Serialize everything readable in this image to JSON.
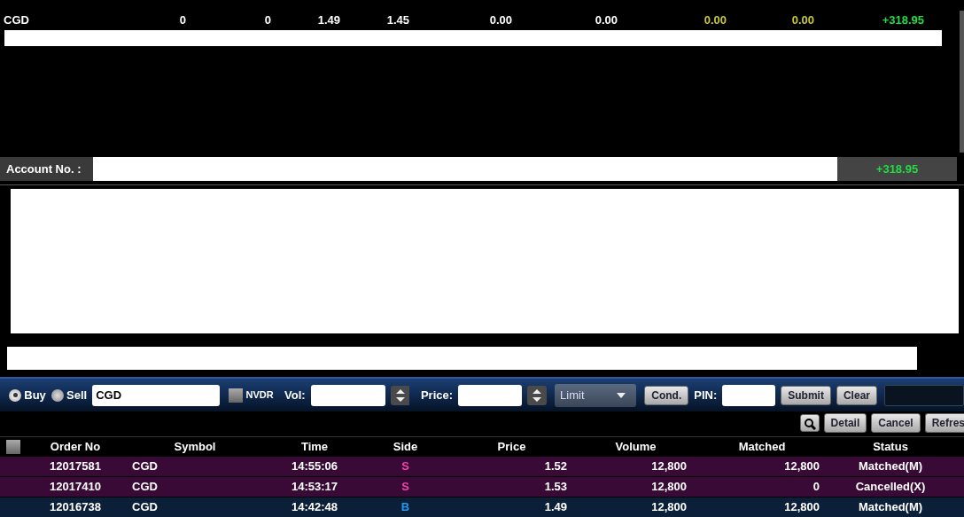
{
  "positions": [
    {
      "symbol": "CGD",
      "values": [
        {
          "text": "0",
          "color": "#ffffff"
        },
        {
          "text": "0",
          "color": "#ffffff"
        },
        {
          "text": "1.49",
          "color": "#ffffff"
        },
        {
          "text": "1.45",
          "color": "#ffffff"
        },
        {
          "text": "0.00",
          "color": "#ffffff"
        },
        {
          "text": "0.00",
          "color": "#ffffff"
        },
        {
          "text": "0.00",
          "color": "#c8c83a"
        },
        {
          "text": "0.00",
          "color": "#c8c83a"
        },
        {
          "text": "+318.95",
          "color": "#22dd44"
        }
      ]
    }
  ],
  "account": {
    "label": "Account No. :",
    "total": "+318.95"
  },
  "order_form": {
    "sides": [
      {
        "label": "Buy",
        "selected": true
      },
      {
        "label": "Sell",
        "selected": false
      }
    ],
    "symbol": "CGD",
    "nvdr": {
      "label": "NVDR",
      "checked": false
    },
    "vol_label": "Vol:",
    "price_label": "Price:",
    "order_type": "Limit",
    "cond_button": "Cond.",
    "pin_label": "PIN:",
    "submit": "Submit",
    "clear": "Clear"
  },
  "actions": [
    "Detail",
    "Cancel",
    "Refres"
  ],
  "orders": {
    "select_all": false,
    "columns": [
      "Order No",
      "Symbol",
      "Time",
      "Side",
      "Price",
      "Volume",
      "Matched",
      "Status"
    ],
    "rows": [
      {
        "order_no": "12017581",
        "symbol": "CGD",
        "time": "14:55:06",
        "side": "S",
        "kind": "sell",
        "price": "1.52",
        "volume": "12,800",
        "matched": "12,800",
        "status": "Matched(M)"
      },
      {
        "order_no": "12017410",
        "symbol": "CGD",
        "time": "14:53:17",
        "side": "S",
        "kind": "sell",
        "price": "1.53",
        "volume": "12,800",
        "matched": "0",
        "status": "Cancelled(X)"
      },
      {
        "order_no": "12016738",
        "symbol": "CGD",
        "time": "14:42:48",
        "side": "B",
        "kind": "buy",
        "price": "1.49",
        "volume": "12,800",
        "matched": "12,800",
        "status": "Matched(M)"
      }
    ]
  }
}
